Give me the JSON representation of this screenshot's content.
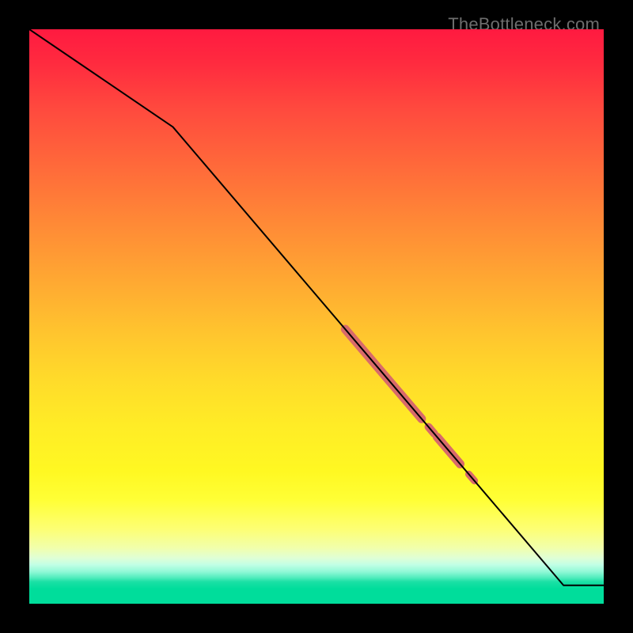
{
  "watermark": "TheBottleneck.com",
  "chart_data": {
    "type": "line",
    "title": "",
    "xlabel": "",
    "ylabel": "",
    "xlim": [
      0,
      100
    ],
    "ylim": [
      0,
      100
    ],
    "grid": false,
    "legend": false,
    "series": [
      {
        "name": "bottleneck-curve",
        "x": [
          0,
          25,
          93,
          100
        ],
        "y": [
          100,
          83,
          3.2,
          3.2
        ],
        "stroke": "#000000",
        "stroke_width": 2
      }
    ],
    "highlight_segments": [
      {
        "name": "highlight-main",
        "on_series": "bottleneck-curve",
        "x_start": 55.0,
        "x_end": 68.3,
        "color": "#d86a6a",
        "width": 11
      },
      {
        "name": "highlight-dot-1",
        "on_series": "bottleneck-curve",
        "x_start": 69.5,
        "x_end": 70.5,
        "color": "#d86a6a",
        "width": 10
      },
      {
        "name": "highlight-short",
        "on_series": "bottleneck-curve",
        "x_start": 71.0,
        "x_end": 75.0,
        "color": "#d86a6a",
        "width": 11
      },
      {
        "name": "highlight-dot-2",
        "on_series": "bottleneck-curve",
        "x_start": 76.5,
        "x_end": 77.5,
        "color": "#d86a6a",
        "width": 9
      }
    ],
    "background_gradient": {
      "direction": "vertical",
      "stops": [
        {
          "pos": 0.0,
          "color": "#ff1a40"
        },
        {
          "pos": 0.5,
          "color": "#ffc22d"
        },
        {
          "pos": 0.8,
          "color": "#ffff30"
        },
        {
          "pos": 0.92,
          "color": "#e0ffd5"
        },
        {
          "pos": 0.97,
          "color": "#00dd9b"
        },
        {
          "pos": 1.0,
          "color": "#00dd9b"
        }
      ]
    }
  }
}
